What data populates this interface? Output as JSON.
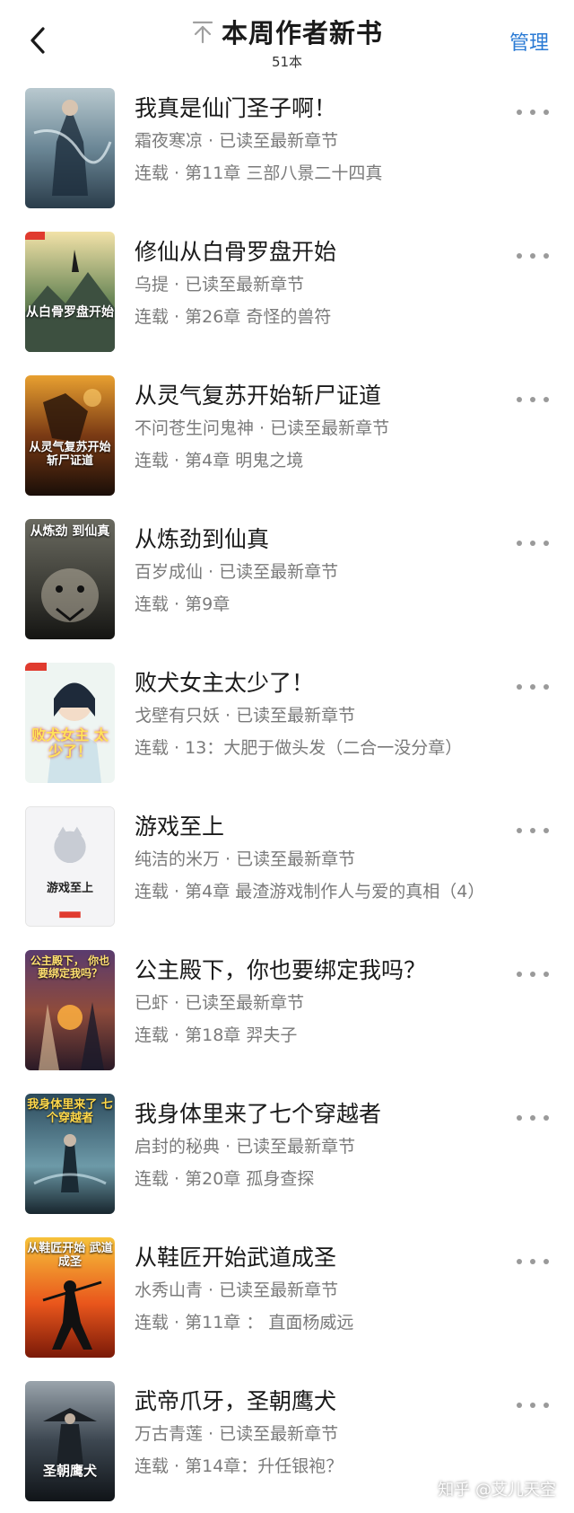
{
  "header": {
    "title": "本周作者新书",
    "count": "51本",
    "manage": "管理"
  },
  "colors": {
    "accent": "#2a7ad4",
    "text": "#1a1a1a",
    "muted": "#7a7a7a"
  },
  "books": [
    {
      "title": "我真是仙门圣子啊！",
      "meta": "霜夜寒凉 · 已读至最新章节",
      "chapter": "连载 · 第11章 三部八景二十四真",
      "cover_text": ""
    },
    {
      "title": "修仙从白骨罗盘开始",
      "meta": "乌提 · 已读至最新章节",
      "chapter": "连载 · 第26章 奇怪的兽符",
      "cover_text": "从白骨罗盘开始"
    },
    {
      "title": "从灵气复苏开始斩尸证道",
      "meta": "不问苍生问鬼神 · 已读至最新章节",
      "chapter": "连载 · 第4章 明鬼之境",
      "cover_text": "从灵气复苏开始 斩尸证道"
    },
    {
      "title": "从炼劲到仙真",
      "meta": "百岁成仙 · 已读至最新章节",
      "chapter": "连载 · 第9章",
      "cover_text": "从炼劲 到仙真"
    },
    {
      "title": "败犬女主太少了！",
      "meta": "戈壁有只妖 · 已读至最新章节",
      "chapter": "连载 · 13：大肥于做头发（二合一没分章）",
      "cover_text": "败犬女主 太少了！"
    },
    {
      "title": "游戏至上",
      "meta": "纯洁的米万 · 已读至最新章节",
      "chapter": "连载 · 第4章 最渣游戏制作人与爱的真相（4）",
      "cover_text": "游戏至上"
    },
    {
      "title": "公主殿下，你也要绑定我吗？",
      "meta": "已虾 · 已读至最新章节",
      "chapter": "连载 · 第18章 羿夫子",
      "cover_text": "公主殿下， 你也要绑定我吗？"
    },
    {
      "title": "我身体里来了七个穿越者",
      "meta": "启封的秘典 · 已读至最新章节",
      "chapter": "连载 · 第20章 孤身查探",
      "cover_text": "我身体里来了 七个穿越者"
    },
    {
      "title": "从鞋匠开始武道成圣",
      "meta": "水秀山青 · 已读至最新章节",
      "chapter": "连载 · 第11章 ： 直面杨威远",
      "cover_text": "从鞋匠开始 武道成圣"
    },
    {
      "title": "武帝爪牙，圣朝鹰犬",
      "meta": "万古青莲 · 已读至最新章节",
      "chapter": "连载 · 第14章：升任银袍？",
      "cover_text": "圣朝鹰犬"
    }
  ],
  "watermark": "知乎 @艾儿天空"
}
